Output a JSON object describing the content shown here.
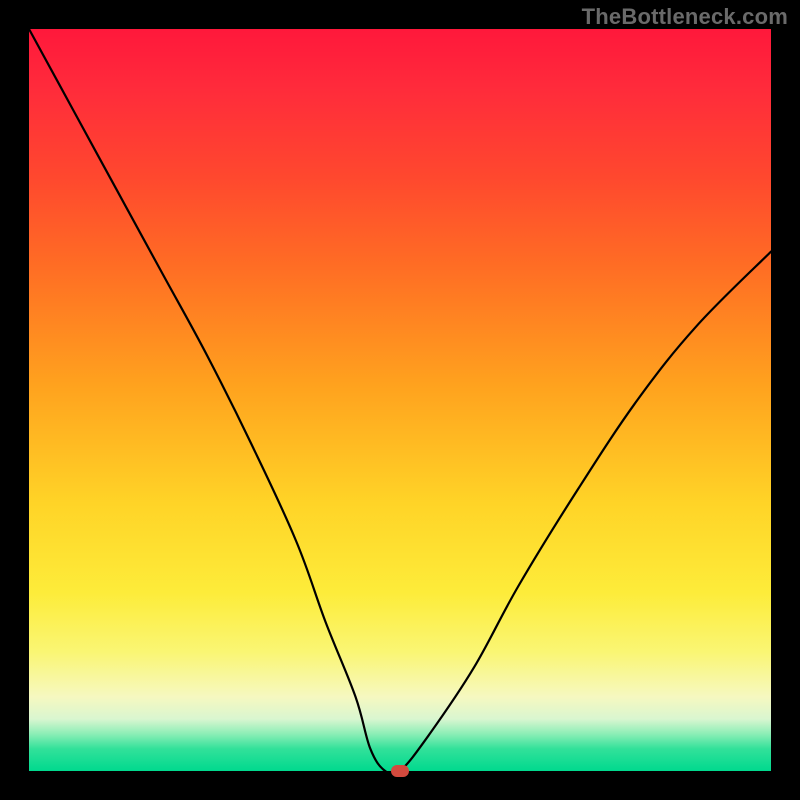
{
  "watermark": "TheBottleneck.com",
  "chart_data": {
    "type": "line",
    "title": "",
    "xlabel": "",
    "ylabel": "",
    "xlim": [
      0,
      100
    ],
    "ylim": [
      0,
      100
    ],
    "series": [
      {
        "name": "bottleneck-curve",
        "x": [
          0,
          6,
          12,
          18,
          24,
          30,
          36,
          40,
          44,
          46,
          48,
          50,
          54,
          60,
          66,
          74,
          82,
          90,
          100
        ],
        "y": [
          100,
          89,
          78,
          67,
          56,
          44,
          31,
          20,
          10,
          3,
          0,
          0,
          5,
          14,
          25,
          38,
          50,
          60,
          70
        ]
      }
    ],
    "marker": {
      "x": 50,
      "y": 0
    },
    "background_gradient": {
      "top_color": "#ff183b",
      "mid_color": "#ffd427",
      "bottom_color": "#00d98e"
    }
  }
}
